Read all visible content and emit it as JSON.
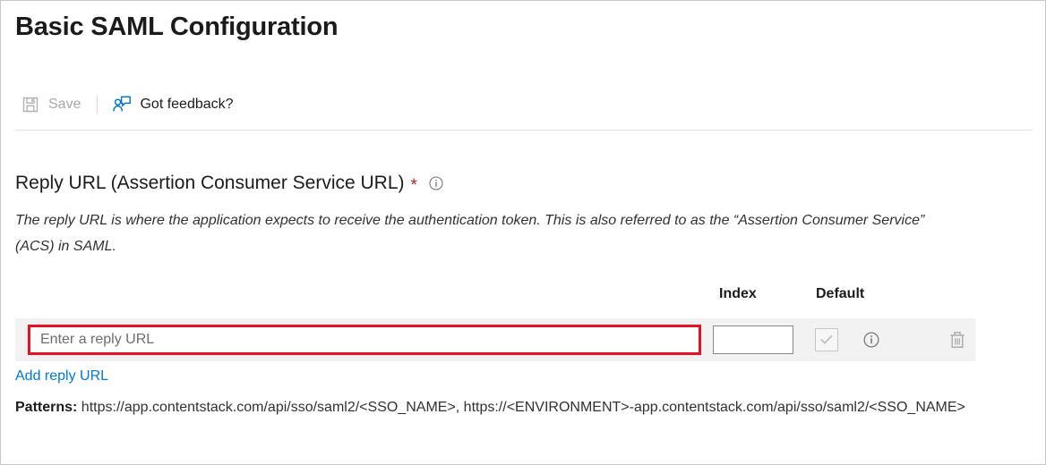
{
  "page": {
    "title": "Basic SAML Configuration"
  },
  "toolbar": {
    "save": {
      "label": "Save",
      "icon": "save-floppy-icon",
      "enabled": false
    },
    "feedback": {
      "label": "Got feedback?",
      "icon": "feedback-person-icon",
      "enabled": true
    }
  },
  "section": {
    "heading": "Reply URL (Assertion Consumer Service URL)",
    "required_marker": "*",
    "info_icon": "info-circle-icon",
    "description": "The reply URL is where the application expects to receive the authentication token. This is also referred to as the “Assertion Consumer Service” (ACS) in SAML."
  },
  "table": {
    "columns": {
      "index": "Index",
      "default": "Default"
    },
    "rows": [
      {
        "url_value": "",
        "url_placeholder": "Enter a reply URL",
        "index_value": "",
        "index_placeholder": "",
        "default_checked": true,
        "default_disabled": true,
        "info_icon": "info-circle-icon",
        "delete_icon": "trash-delete-icon"
      }
    ]
  },
  "actions": {
    "add_reply_url": "Add reply URL"
  },
  "patterns": {
    "label": "Patterns:",
    "value": " https://app.contentstack.com/api/sso/saml2/<SSO_NAME>, https://<ENVIRONMENT>-app.contentstack.com/api/sso/saml2/<SSO_NAME>"
  },
  "colors": {
    "accent_blue": "#0078d4",
    "required_red": "#a4262c",
    "highlight_red": "#e81123",
    "row_background": "#f2f2f2",
    "text_primary": "#1b1b1b",
    "text_disabled": "#a9a9a9"
  }
}
